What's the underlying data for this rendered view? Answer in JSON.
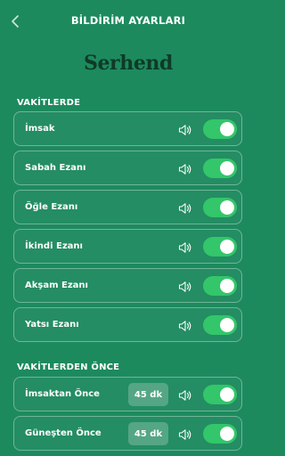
{
  "header": {
    "title": "BİLDİRİM AYARLARI"
  },
  "brand": {
    "logo_text": "Serhend"
  },
  "sections": {
    "vakitlerde": {
      "title": "VAKİTLERDE",
      "items": [
        {
          "label": "İmsak",
          "sound_icon": "speaker-icon",
          "enabled": true
        },
        {
          "label": "Sabah Ezanı",
          "sound_icon": "speaker-icon",
          "enabled": true
        },
        {
          "label": "Öğle Ezanı",
          "sound_icon": "speaker-icon",
          "enabled": true
        },
        {
          "label": "İkindi Ezanı",
          "sound_icon": "speaker-icon",
          "enabled": true
        },
        {
          "label": "Akşam Ezanı",
          "sound_icon": "speaker-icon",
          "enabled": true
        },
        {
          "label": "Yatsı Ezanı",
          "sound_icon": "speaker-icon",
          "enabled": true
        }
      ]
    },
    "oncesi": {
      "title": "VAKİTLERDEN ÖNCE",
      "items": [
        {
          "label": "İmsaktan Önce",
          "minutes": "45 dk",
          "sound_icon": "speaker-icon",
          "enabled": true
        },
        {
          "label": "Güneşten Önce",
          "minutes": "45 dk",
          "sound_icon": "speaker-icon",
          "enabled": true
        }
      ]
    }
  },
  "colors": {
    "background": "#1d8a5e",
    "toggle_on": "#33c66a",
    "logo": "#0f3a26"
  }
}
